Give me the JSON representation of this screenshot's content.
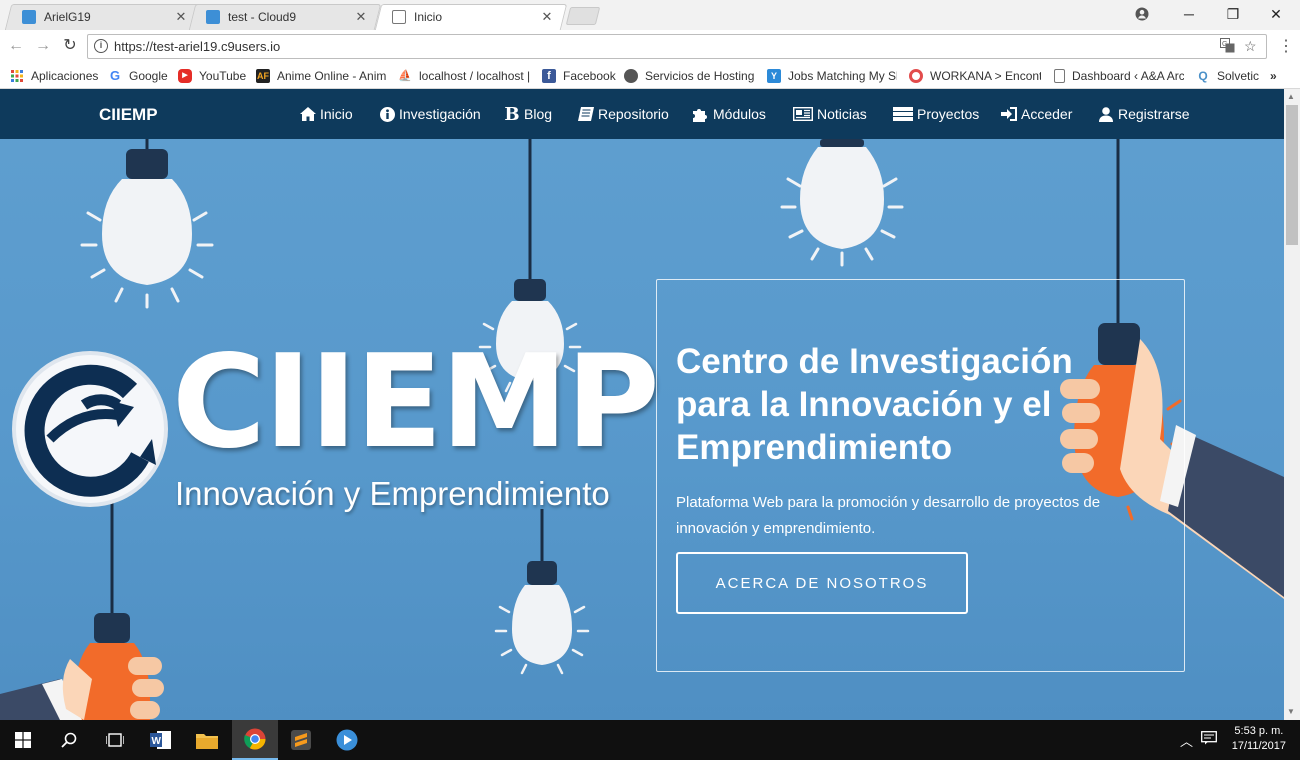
{
  "browser": {
    "tabs": [
      {
        "title": "ArielG19",
        "active": false
      },
      {
        "title": "test - Cloud9",
        "active": false
      },
      {
        "title": "Inicio",
        "active": true
      }
    ],
    "url": "https://test-ariel19.c9users.io",
    "bookmarks": [
      {
        "label": "Aplicaciones",
        "icon": "apps-grid-icon"
      },
      {
        "label": "Google",
        "icon": "google-icon"
      },
      {
        "label": "YouTube",
        "icon": "youtube-icon"
      },
      {
        "label": "Anime Online - Anim",
        "icon": "anime-flv-icon"
      },
      {
        "label": "localhost / localhost |",
        "icon": "phpmyadmin-icon"
      },
      {
        "label": "Facebook",
        "icon": "facebook-icon"
      },
      {
        "label": "Servicios de Hosting",
        "icon": "hosting-icon"
      },
      {
        "label": "Jobs Matching My Sk",
        "icon": "jobs-icon"
      },
      {
        "label": "WORKANA > Encontr",
        "icon": "workana-icon"
      },
      {
        "label": "Dashboard ‹ A&A Arc",
        "icon": "page-icon"
      },
      {
        "label": "Solvetic",
        "icon": "solvetic-icon"
      }
    ]
  },
  "site": {
    "brand": "CIIEMP",
    "nav": [
      {
        "label": "Inicio",
        "icon": "home-icon"
      },
      {
        "label": "Investigación",
        "icon": "info-icon"
      },
      {
        "label": "Blog",
        "icon": "blogger-icon"
      },
      {
        "label": "Repositorio",
        "icon": "book-icon"
      },
      {
        "label": "Módulos",
        "icon": "puzzle-icon"
      },
      {
        "label": "Noticias",
        "icon": "newspaper-icon"
      },
      {
        "label": "Proyectos",
        "icon": "server-icon"
      },
      {
        "label": "Acceder",
        "icon": "sign-in-icon"
      },
      {
        "label": "Registrarse",
        "icon": "user-icon"
      }
    ],
    "hero": {
      "logo_title": "CIIEMP",
      "logo_subtitle": "Innovación y Emprendimiento",
      "heading": "Centro de Investigación para la Innovación y el Emprendimiento",
      "description": "Plataforma Web para la promoción y desarrollo de proyectos de innovación y emprendimiento.",
      "cta": "ACERCA DE NOSOTROS"
    }
  },
  "taskbar": {
    "time": "5:53 p. m.",
    "date": "17/11/2017"
  },
  "colors": {
    "navbar": "#0e3a5c",
    "hero_bg": "#5a9ccd",
    "bulb_orange": "#f26b2a"
  }
}
